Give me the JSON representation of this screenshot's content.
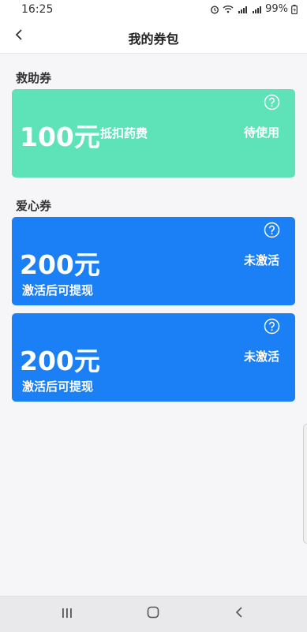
{
  "status_bar": {
    "time": "16:25",
    "battery": "99%",
    "icons": [
      "alarm-icon",
      "wifi-icon",
      "signal-4g-icon",
      "signal-4g-icon",
      "battery-icon"
    ]
  },
  "header": {
    "title": "我的券包",
    "back_icon": "chevron-left-icon"
  },
  "sections": [
    {
      "title": "救助券",
      "cards": [
        {
          "amount": "100元",
          "description": "抵扣药费",
          "status": "待使用",
          "color": "#5ee3b8"
        }
      ]
    },
    {
      "title": "爱心券",
      "cards": [
        {
          "amount": "200元",
          "description": "激活后可提现",
          "status": "未激活",
          "color": "#1b7ff5"
        },
        {
          "amount": "200元",
          "description": "激活后可提现",
          "status": "未激活",
          "color": "#1b7ff5"
        }
      ]
    }
  ],
  "nav_bar": {
    "buttons": [
      "recent-apps-icon",
      "home-icon",
      "back-icon"
    ]
  }
}
